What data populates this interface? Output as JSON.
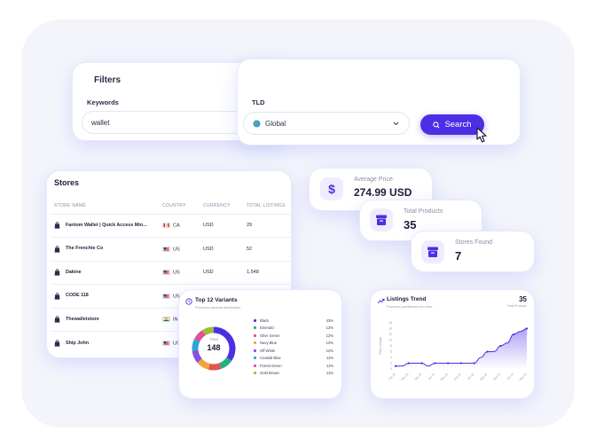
{
  "filters": {
    "title": "Filters",
    "keywords_label": "Keywords",
    "keywords_value": "wallet",
    "tld_label": "TLD",
    "tld_value": "Global",
    "search_button": "Search"
  },
  "stores": {
    "title": "Stores",
    "columns": [
      "STORE NAME",
      "COUNTRY",
      "CURRENCY",
      "TOTAL LISTINGS"
    ],
    "rows": [
      {
        "name": "Fantom Wallet | Quick Access Min...",
        "country": "CA",
        "currency": "USD",
        "listings": "29"
      },
      {
        "name": "The Frenchie Co",
        "country": "US",
        "currency": "USD",
        "listings": "52"
      },
      {
        "name": "Dakine",
        "country": "US",
        "currency": "USD",
        "listings": "1,548"
      },
      {
        "name": "CODE 118",
        "country": "US",
        "currency": "USD",
        "listings": ""
      },
      {
        "name": "Thewalletstore",
        "country": "IN",
        "currency": "",
        "listings": ""
      },
      {
        "name": "Ship John",
        "country": "US",
        "currency": "",
        "listings": ""
      }
    ]
  },
  "stats": {
    "avg_price_label": "Average Price",
    "avg_price_value": "274.99 USD",
    "total_products_label": "Total Products",
    "total_products_value": "35",
    "stores_found_label": "Stores Found",
    "stores_found_value": "7"
  },
  "variants": {
    "title": "Top 12 Variants",
    "subtitle": "Products variants distribution",
    "total_label": "Total",
    "total_value": "148",
    "items": [
      {
        "name": "Black",
        "pct": "43%",
        "color": "#4b2fe6"
      },
      {
        "name": "Emerald",
        "pct": "12%",
        "color": "#22b07d"
      },
      {
        "name": "Olive Green",
        "pct": "12%",
        "color": "#e0564f"
      },
      {
        "name": "Navy Blue",
        "pct": "12%",
        "color": "#f2a33a"
      },
      {
        "name": "Off White",
        "pct": "12%",
        "color": "#8a4fe0"
      },
      {
        "name": "Coastal Blue",
        "pct": "11%",
        "color": "#2aa5d6"
      },
      {
        "name": "Forest Green",
        "pct": "11%",
        "color": "#e04f9a"
      },
      {
        "name": "Gold Brown",
        "pct": "11%",
        "color": "#9dbb3a"
      }
    ],
    "chart_data": {
      "type": "pie",
      "categories": [
        "Black",
        "Emerald",
        "Olive Green",
        "Navy Blue",
        "Off White",
        "Coastal Blue",
        "Forest Green",
        "Gold Brown"
      ],
      "values": [
        43,
        12,
        12,
        12,
        12,
        11,
        11,
        11
      ]
    }
  },
  "trend": {
    "title": "Listings Trend",
    "subtitle": "Products published over time",
    "total_value": "35",
    "total_label": "Total Products",
    "ylabel": "Total Listings",
    "chart_data": {
      "type": "area",
      "x": [
        "Jan 23",
        "Mar 23",
        "May 23",
        "Jul 23",
        "Sep 23",
        "Nov 23",
        "Jan 24",
        "Mar 24",
        "May 24",
        "Jul 24",
        "Sep 24",
        "Nov 24",
        "Jan 25",
        "Mar 25",
        "May 25",
        "Jul 25",
        "Sep 25",
        "Nov 25",
        "Jan 26",
        "Mar 26",
        "May 26"
      ],
      "values": [
        1,
        1,
        2,
        2,
        2,
        1,
        2,
        2,
        2,
        2,
        2,
        2,
        2,
        4,
        6,
        6,
        8,
        9,
        12,
        13,
        14
      ],
      "ylim": [
        0,
        16
      ],
      "yticks": [
        0,
        2,
        4,
        6,
        8,
        10,
        12,
        14,
        16
      ],
      "xtick_labels": [
        "Jan 23",
        "Nov 23",
        "Sep 24",
        "Jul 25",
        "May 26"
      ]
    }
  },
  "colors": {
    "accent": "#4b2fe6",
    "background": "#f4f5fb"
  },
  "icons": {
    "search": "search-icon",
    "dollar": "dollar-icon",
    "box": "box-icon",
    "store": "store-icon",
    "globe": "globe-icon"
  }
}
